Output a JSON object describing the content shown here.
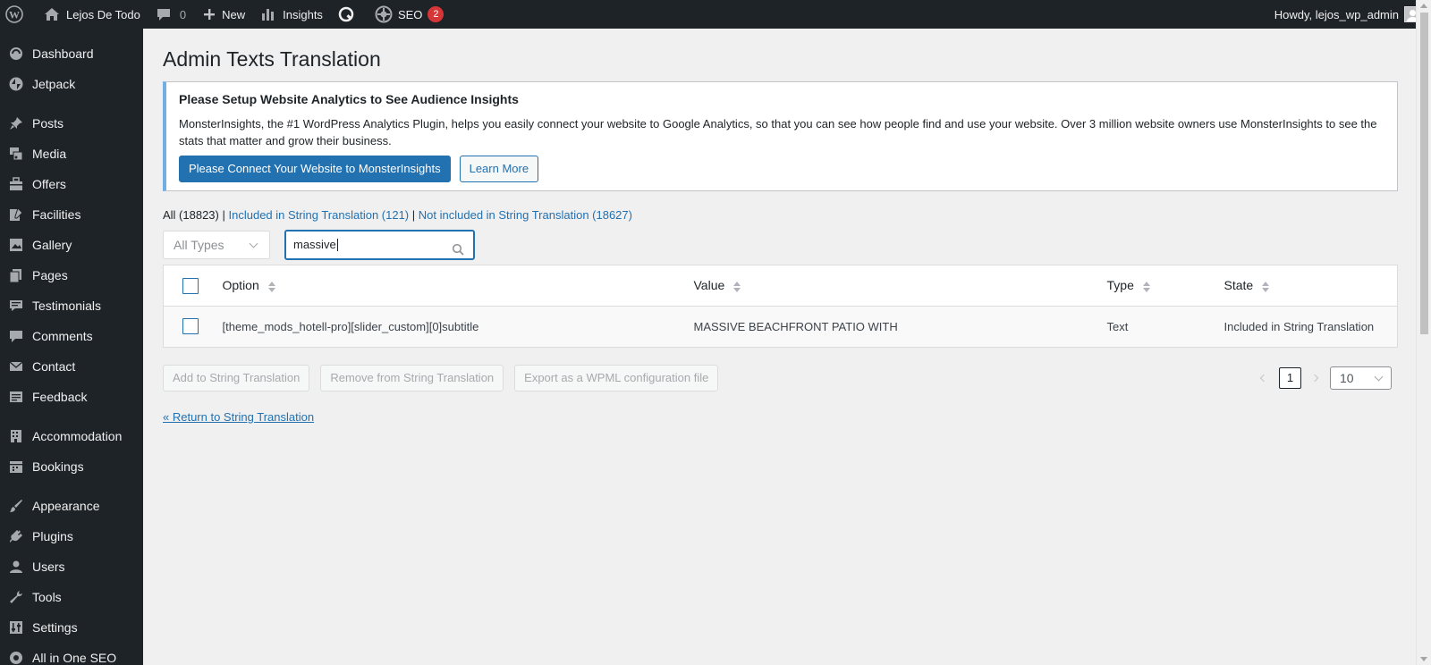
{
  "adminbar": {
    "site_name": "Lejos De Todo",
    "comments_count": "0",
    "new_label": "New",
    "insights_label": "Insights",
    "seo_label": "SEO",
    "seo_badge": "2",
    "howdy": "Howdy, lejos_wp_admin"
  },
  "sidebar": {
    "items": [
      {
        "label": "Dashboard",
        "icon": "dashboard-icon"
      },
      {
        "label": "Jetpack",
        "icon": "jetpack-icon"
      },
      {
        "label": "Posts",
        "icon": "pin-icon"
      },
      {
        "label": "Media",
        "icon": "media-icon"
      },
      {
        "label": "Offers",
        "icon": "offers-icon"
      },
      {
        "label": "Facilities",
        "icon": "facilities-icon"
      },
      {
        "label": "Gallery",
        "icon": "gallery-icon"
      },
      {
        "label": "Pages",
        "icon": "pages-icon"
      },
      {
        "label": "Testimonials",
        "icon": "testimonials-icon"
      },
      {
        "label": "Comments",
        "icon": "comments-icon"
      },
      {
        "label": "Contact",
        "icon": "mail-icon"
      },
      {
        "label": "Feedback",
        "icon": "feedback-icon"
      },
      {
        "label": "Accommodation",
        "icon": "building-icon"
      },
      {
        "label": "Bookings",
        "icon": "calendar-icon"
      },
      {
        "label": "Appearance",
        "icon": "brush-icon"
      },
      {
        "label": "Plugins",
        "icon": "plugin-icon"
      },
      {
        "label": "Users",
        "icon": "users-icon"
      },
      {
        "label": "Tools",
        "icon": "wrench-icon"
      },
      {
        "label": "Settings",
        "icon": "settings-icon"
      },
      {
        "label": "All in One SEO",
        "icon": "seo-icon"
      }
    ]
  },
  "page": {
    "title": "Admin Texts Translation"
  },
  "notice": {
    "heading": "Please Setup Website Analytics to See Audience Insights",
    "body": "MonsterInsights, the #1 WordPress Analytics Plugin, helps you easily connect your website to Google Analytics, so that you can see how people find and use your website. Over 3 million website owners use MonsterInsights to see the stats that matter and grow their business.",
    "primary_button": "Please Connect Your Website to MonsterInsights",
    "secondary_button": "Learn More"
  },
  "views": {
    "all": "All (18823)",
    "sep": "|",
    "included": "Included in String Translation (121)",
    "not_included": "Not included in String Translation (18627)"
  },
  "filters": {
    "type_select": "All Types",
    "search_value": "massive"
  },
  "table": {
    "headers": {
      "option": "Option",
      "value": "Value",
      "type": "Type",
      "state": "State"
    },
    "rows": [
      {
        "option": "[theme_mods_hotell-pro][slider_custom][0]subtitle",
        "value": "MASSIVE BEACHFRONT PATIO WITH",
        "type": "Text",
        "state": "Included in String Translation"
      }
    ]
  },
  "actions": {
    "add": "Add to String Translation",
    "remove": "Remove from String Translation",
    "export": "Export as a WPML configuration file"
  },
  "pagination": {
    "current_page": "1",
    "per_page": "10"
  },
  "return_link": "« Return to String Translation",
  "colors": {
    "adminbar_bg": "#1d2327",
    "accent": "#2271b1",
    "badge": "#d63638",
    "notice_border": "#72aee6"
  }
}
